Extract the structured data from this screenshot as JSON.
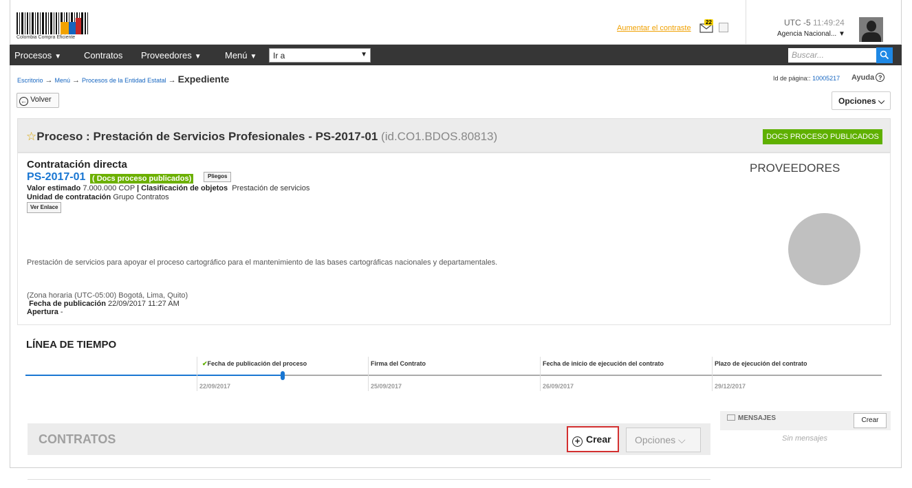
{
  "header": {
    "logo_caption": "Colombia Compra Eficiente",
    "contrast_link": "Aumentar el contraste",
    "mail_count": "22",
    "utc_label": "UTC -5",
    "time": "11:49:24",
    "agency": "Agencia Nacional..."
  },
  "nav": {
    "items": [
      "Procesos",
      "Contratos",
      "Proveedores",
      "Menú"
    ],
    "goto_value": "Ir a",
    "search_placeholder": "Buscar..."
  },
  "breadcrumb": {
    "items": [
      "Escritorio",
      "Menú",
      "Procesos de la Entidad Estatal"
    ],
    "current": "Expediente",
    "page_id_label": "Id de página::",
    "page_id_value": "10005217",
    "help": "Ayuda"
  },
  "actions": {
    "back": "Volver",
    "options": "Opciones"
  },
  "process": {
    "title": "Proceso : Prestación de Servicios Profesionales  - PS-2017-01",
    "id": "(id.CO1.BDOS.80813)",
    "badge": "DOCS PROCESO PUBLICADOS",
    "contract_type": "Contratación directa",
    "code": "PS-2017-01",
    "pub_badge": "( Docs proceso publicados)",
    "pliegos": "Pliegos",
    "valor_label": "Valor estimado",
    "valor_value": "7.000.000 COP",
    "clasif_label": "| Clasificación de objetos",
    "clasif_value": "Prestación de servicios",
    "unidad_label": "Unidad de contratación",
    "unidad_value": "Grupo Contratos",
    "ver_enlace": "Ver Enlace",
    "description": "Prestación de servicios para apoyar el proceso cartográfico para el mantenimiento de las bases cartográficas nacionales y departamentales.",
    "timezone": "(Zona horaria (UTC-05:00) Bogotá, Lima, Quito)",
    "pub_label": "Fecha de publicación",
    "pub_value": "22/09/2017 11:27 AM",
    "apertura_label": "Apertura",
    "apertura_value": "-",
    "providers_title": "PROVEEDORES"
  },
  "timeline": {
    "title": "LÍNEA DE TIEMPO",
    "steps": [
      {
        "label": "Fecha de publicación del proceso",
        "date": "22/09/2017"
      },
      {
        "label": "Firma del Contrato",
        "date": "25/09/2017"
      },
      {
        "label": "Fecha de inicio de ejecución del contrato",
        "date": "26/09/2017"
      },
      {
        "label": "Plazo de ejecución del contrato",
        "date": "29/12/2017"
      }
    ]
  },
  "messages": {
    "title": "MENSAJES",
    "create": "Crear",
    "empty": "Sin mensajes"
  },
  "contracts": {
    "title": "CONTRATOS",
    "create": "Crear",
    "options": "Opciones"
  },
  "colors": {
    "nav_bg": "#363636",
    "accent_blue": "#1976d2",
    "badge_green": "#5fb000",
    "highlight_red": "#d32f2f"
  }
}
